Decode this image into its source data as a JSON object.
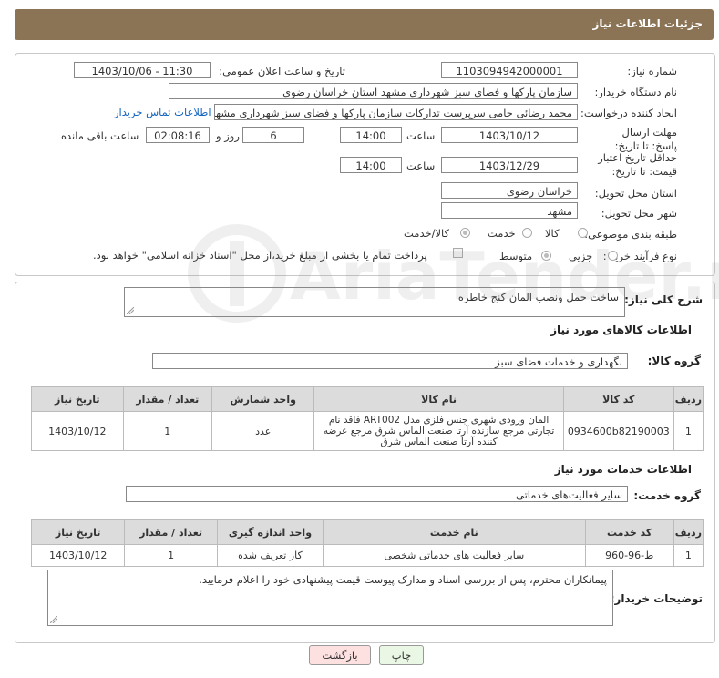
{
  "header": {
    "title": "جزئیات اطلاعات نیاز"
  },
  "labels": {
    "need_number": "شماره نیاز:",
    "announce_datetime": "تاریخ و ساعت اعلان عمومی:",
    "buyer_org": "نام دستگاه خریدار:",
    "requester": "ایجاد کننده درخواست:",
    "reply_deadline": "مهلت ارسال پاسخ: تا تاریخ:",
    "price_validity": "حداقل تاریخ اعتبار قیمت: تا تاریخ:",
    "delivery_province": "استان محل تحویل:",
    "delivery_city": "شهر محل تحویل:",
    "subject_class": "طبقه بندی موضوعی:",
    "purchase_type": "نوع فرآیند خرید :",
    "time": "ساعت",
    "days_and": "روز و",
    "remaining": "ساعت باقی مانده"
  },
  "fields": {
    "need_number": "1103094942000001",
    "announce_datetime": "1403/10/06 - 11:30",
    "buyer_org": "سازمان پارکها و فضای سبز شهرداری مشهد استان خراسان رضوی",
    "requester": "محمد رضائی جامی سرپرست تدارکات سازمان پارکها و فضای سبز شهرداری مشهد",
    "contact_link": "اطلاعات تماس خریدار",
    "reply_date": "1403/10/12",
    "reply_time": "14:00",
    "reply_days": "6",
    "reply_remaining": "02:08:16",
    "validity_date": "1403/12/29",
    "validity_time": "14:00",
    "province": "خراسان رضوی",
    "city": "مشهد"
  },
  "subject_options": [
    "کالا",
    "خدمت",
    "کالا/خدمت"
  ],
  "purchase_options": [
    "جزیی",
    "متوسط"
  ],
  "purchase_note": "پرداخت تمام یا بخشی از مبلغ خرید،از محل \"اسناد خزانه اسلامی\" خواهد بود.",
  "general_desc": {
    "label": "شرح کلی نیاز:",
    "value": "ساخت حمل ونصب المان کنج خاطره"
  },
  "goods_section": {
    "title": "اطلاعات کالاهای مورد نیاز",
    "group_label": "گروه کالا:",
    "group_value": "نگهداری و خدمات فضای سبز",
    "headers": [
      "ردیف",
      "کد کالا",
      "نام کالا",
      "واحد شمارش",
      "تعداد / مقدار",
      "تاریخ نیاز"
    ],
    "rows": [
      {
        "index": "1",
        "code": "0934600b82190003",
        "name": "المان ورودی شهری جنس فلزی مدل ART002 فاقد نام تجارتی مرجع سازنده آرتا صنعت الماس شرق مرجع عرضه کننده آرتا صنعت الماس شرق",
        "unit": "عدد",
        "qty": "1",
        "date": "1403/10/12"
      }
    ]
  },
  "services_section": {
    "title": "اطلاعات خدمات مورد نیاز",
    "group_label": "گروه خدمت:",
    "group_value": "سایر فعالیت‌های خدماتی",
    "headers": [
      "ردیف",
      "کد خدمت",
      "نام خدمت",
      "واحد اندازه گیری",
      "تعداد / مقدار",
      "تاریخ نیاز"
    ],
    "rows": [
      {
        "index": "1",
        "code": "ط-96-960",
        "name": "سایر فعالیت های خدماتی شخصی",
        "unit": "کار تعریف شده",
        "qty": "1",
        "date": "1403/10/12"
      }
    ]
  },
  "buyer_notes": {
    "label": "توضیحات خریدار:",
    "value": "پیمانکاران محترم، پس از بررسی اسناد و مدارک پیوست قیمت پیشنهادی خود را اعلام فرمایید."
  },
  "buttons": {
    "print": "چاپ",
    "back": "بازگشت"
  },
  "watermark": "AriaTender.neT",
  "colors": {
    "header_bg": "#8b7355",
    "back_btn_bg": "#fde0e0",
    "print_btn_bg": "#eaf7e4",
    "link": "#1565c0"
  }
}
